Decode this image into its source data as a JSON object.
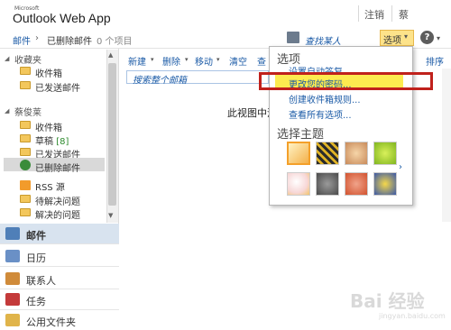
{
  "brand": {
    "ms_label": "Microsoft",
    "app_name": "Outlook Web App"
  },
  "topbar": {
    "signout": "注销",
    "user": "蔡"
  },
  "breadcrumb": {
    "mail": "邮件",
    "separator": "›",
    "folder": "已删除邮件",
    "count": "0 个项目"
  },
  "addressbook": {
    "label": "查找某人"
  },
  "options_button": {
    "label": "选项",
    "caret": "▾"
  },
  "help": {
    "label": "?",
    "caret": "▾"
  },
  "sidebar": {
    "favorites_label": "收藏夹",
    "favorites": [
      {
        "label": "收件箱"
      },
      {
        "label": "已发送邮件"
      }
    ],
    "mailbox_label": "蔡俊莱",
    "mailbox": [
      {
        "label": "收件箱",
        "count": ""
      },
      {
        "label": "草稿",
        "count": "[8]"
      },
      {
        "label": "已发送邮件",
        "count": ""
      },
      {
        "label": "已删除邮件",
        "count": ""
      },
      {
        "label": "RSS 源",
        "count": ""
      },
      {
        "label": "待解决问题",
        "count": ""
      },
      {
        "label": "解决的问题",
        "count": ""
      }
    ]
  },
  "bottom_nav": [
    {
      "label": "邮件"
    },
    {
      "label": "日历"
    },
    {
      "label": "联系人"
    },
    {
      "label": "任务"
    },
    {
      "label": "公用文件夹"
    }
  ],
  "toolbar": {
    "new": "新建",
    "delete": "删除",
    "move": "移动",
    "empty": "清空",
    "more": "查",
    "sort": "排序"
  },
  "search": {
    "placeholder": "搜索整个邮箱"
  },
  "content": {
    "empty_message": "此视图中没"
  },
  "dropdown": {
    "title": "选项",
    "items": [
      "设置自动答复...",
      "更改您的密码...",
      "创建收件箱规则...",
      "查看所有选项..."
    ],
    "theme_title": "选择主题",
    "next": "›"
  },
  "watermark": {
    "text": "Bai 经验",
    "sub": "jingyan.baidu.com"
  },
  "colors": {
    "accent": "#1a5aa6",
    "highlight": "#fdeb4f",
    "annotation": "#c0211c"
  }
}
